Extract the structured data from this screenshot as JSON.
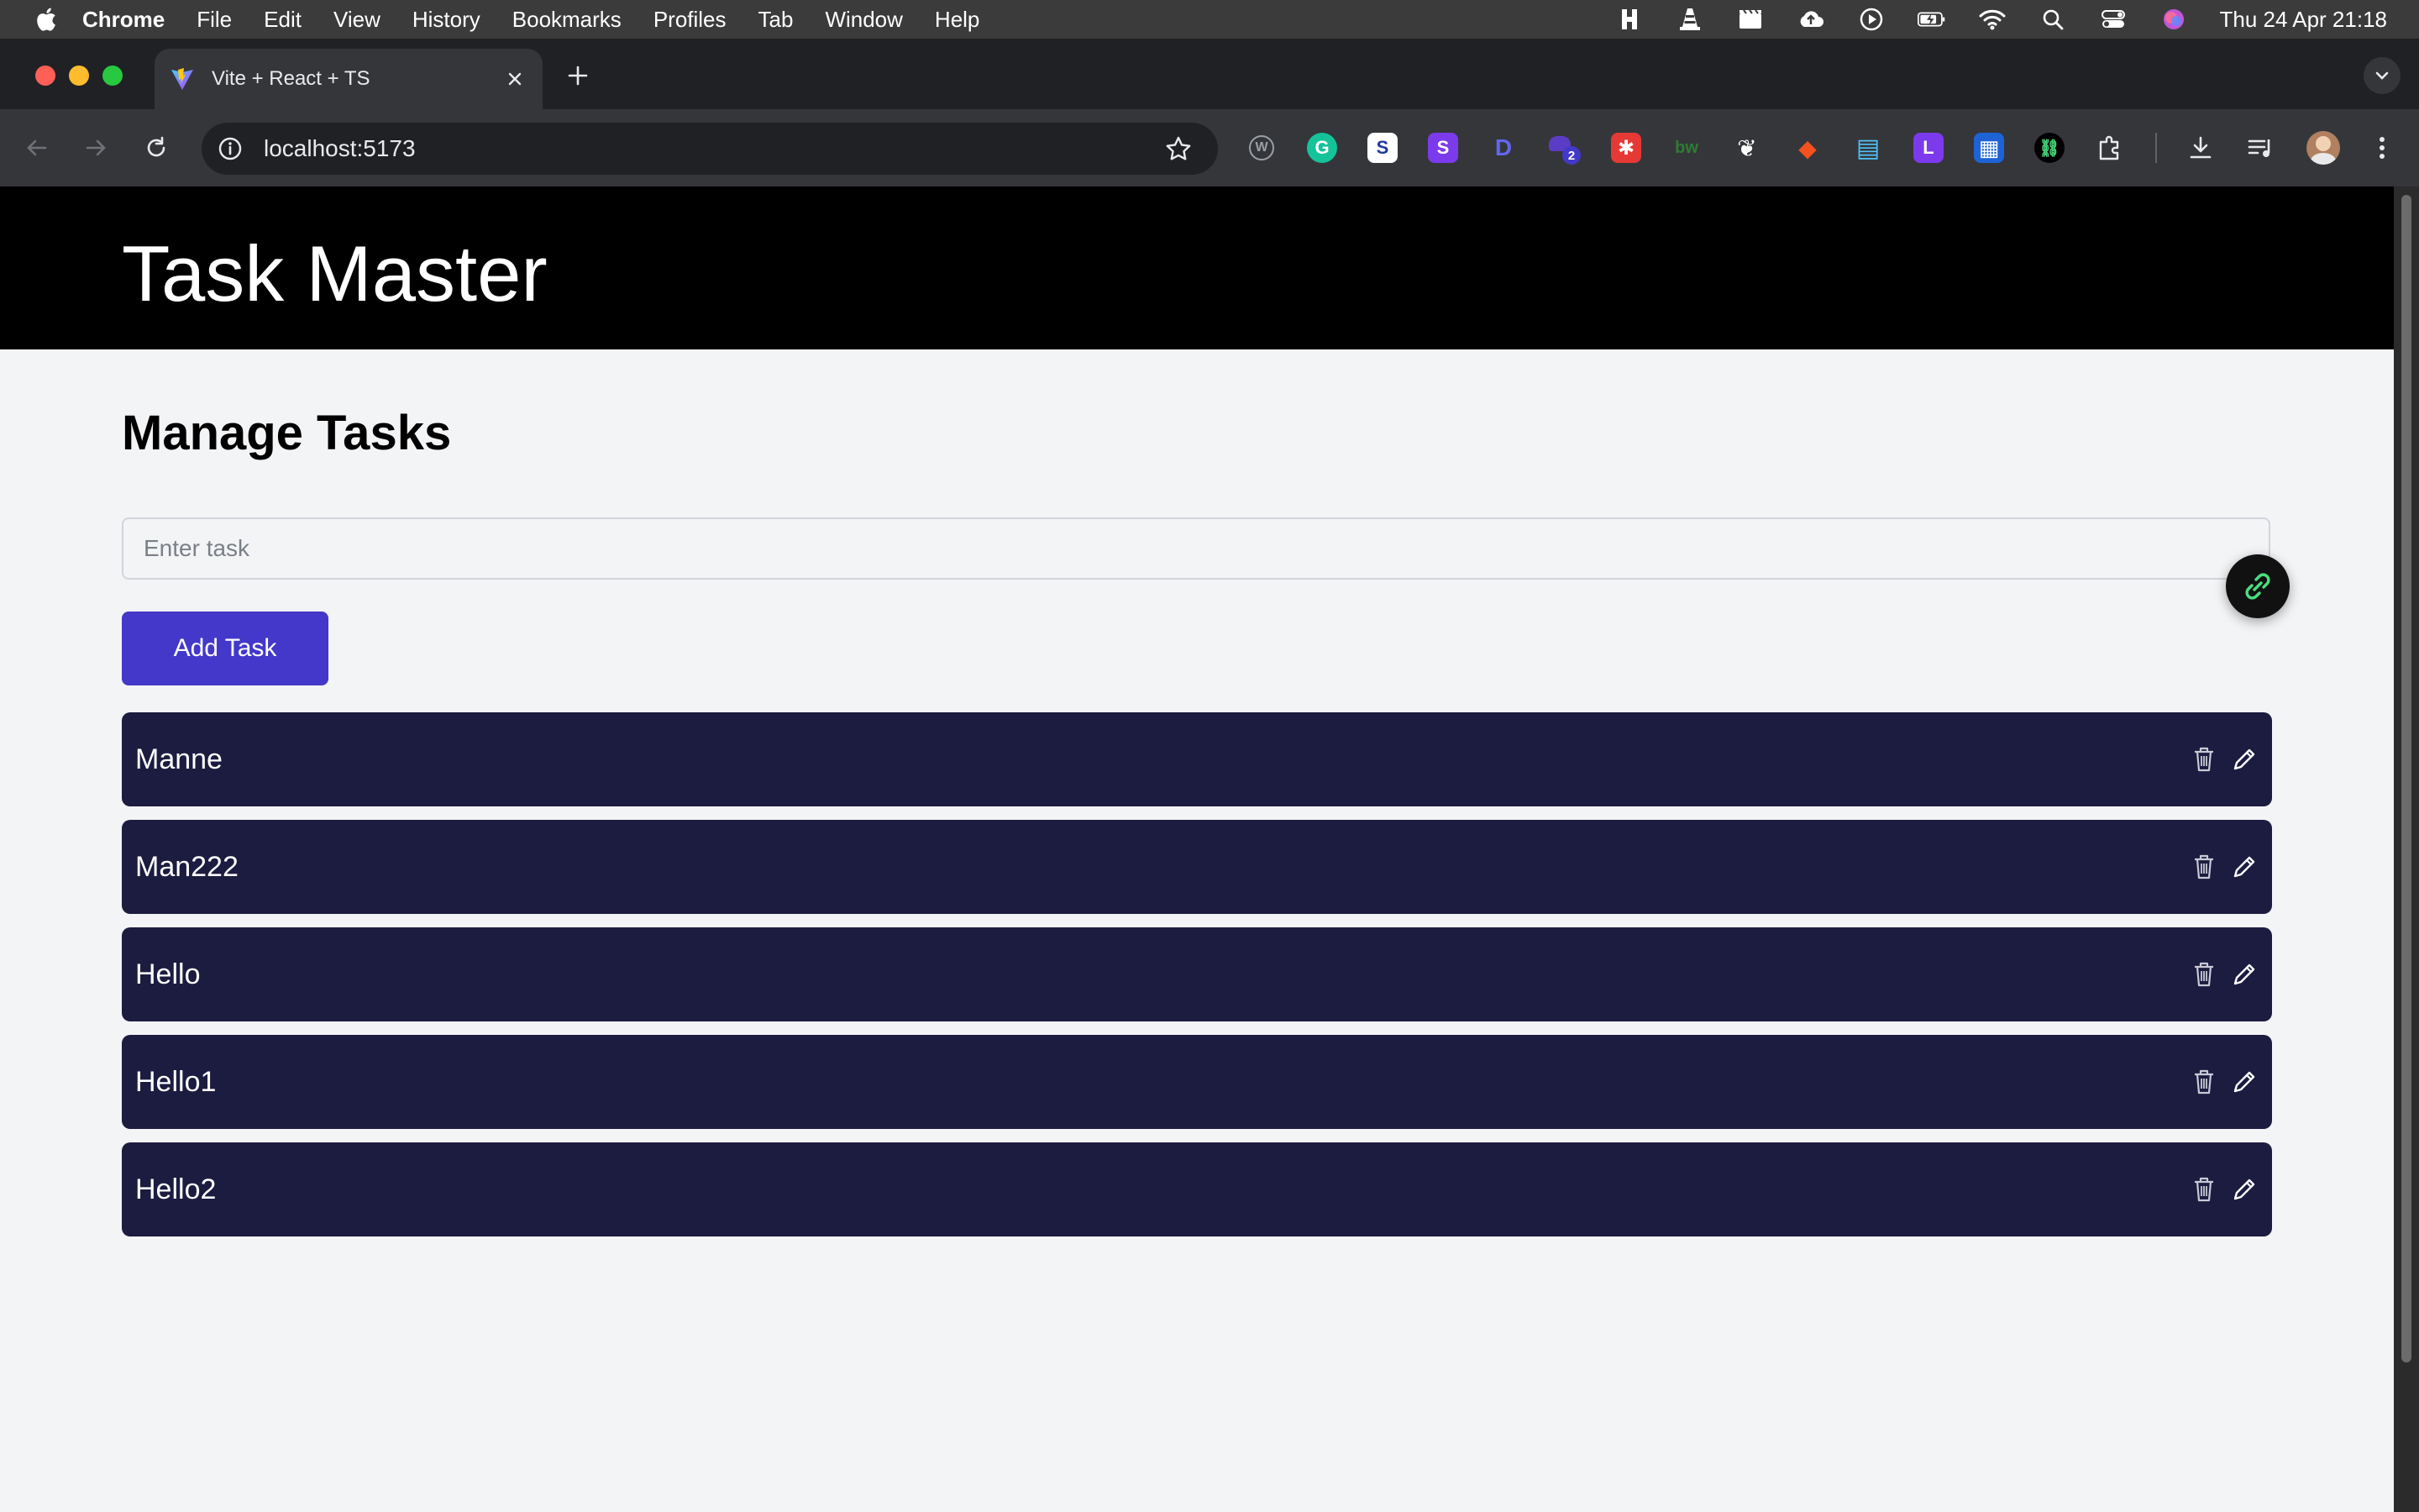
{
  "menubar": {
    "app_name": "Chrome",
    "items": [
      "File",
      "Edit",
      "View",
      "History",
      "Bookmarks",
      "Profiles",
      "Tab",
      "Window",
      "Help"
    ],
    "clock": "Thu 24 Apr  21:18"
  },
  "browser": {
    "tab_title": "Vite + React + TS",
    "url": "localhost:5173",
    "extensions": [
      {
        "name": "wordpress-icon",
        "glyph": "W",
        "color": "#9aa0a6",
        "bg": "transparent"
      },
      {
        "name": "grammarly-icon",
        "glyph": "G",
        "color": "#ffffff",
        "bg": "#15c39a"
      },
      {
        "name": "s-extension-icon",
        "glyph": "S",
        "color": "#1f3b9c",
        "bg": "#ffffff"
      },
      {
        "name": "s-purple-extension-icon",
        "glyph": "S",
        "color": "#ffffff",
        "bg": "#7c3aed"
      },
      {
        "name": "d-extension-icon",
        "glyph": "D",
        "color": "#6366f1",
        "bg": "transparent"
      },
      {
        "name": "badge-extension-icon",
        "glyph": "2",
        "color": "#ffffff",
        "bg": "#4338ca"
      },
      {
        "name": "red-extension-icon",
        "glyph": "✱",
        "color": "#ffffff",
        "bg": "#e53935"
      },
      {
        "name": "bw-extension-icon",
        "glyph": "bw",
        "color": "#1b5e20",
        "bg": "transparent"
      },
      {
        "name": "bird-extension-icon",
        "glyph": "❦",
        "color": "#ffffff",
        "bg": "transparent"
      },
      {
        "name": "orange-extension-icon",
        "glyph": "◆",
        "color": "#f4511e",
        "bg": "transparent"
      },
      {
        "name": "book-extension-icon",
        "glyph": "▤",
        "color": "#4fc3f7",
        "bg": "transparent"
      },
      {
        "name": "l-extension-icon",
        "glyph": "L",
        "color": "#ffffff",
        "bg": "#7c3aed"
      },
      {
        "name": "calendar-extension-icon",
        "glyph": "▦",
        "color": "#ffffff",
        "bg": "#1e63d6"
      },
      {
        "name": "link-extension-icon",
        "glyph": "⛓",
        "color": "#4ade80",
        "bg": "#000000"
      }
    ]
  },
  "page": {
    "site_title": "Task Master",
    "heading": "Manage Tasks",
    "input_placeholder": "Enter task",
    "add_button_label": "Add Task",
    "tasks": [
      {
        "name": "Manne"
      },
      {
        "name": "Man222"
      },
      {
        "name": "Hello"
      },
      {
        "name": "Hello1"
      },
      {
        "name": "Hello2"
      }
    ]
  },
  "colors": {
    "header_bg": "#000000",
    "page_bg": "#f3f4f6",
    "button_bg": "#4338ca",
    "task_bg": "#1c1b40"
  }
}
